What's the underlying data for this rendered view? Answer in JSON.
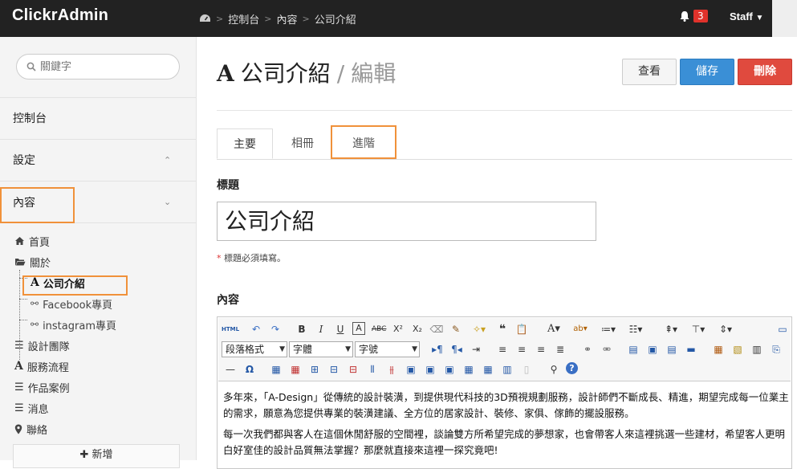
{
  "brand": "ClickrAdmin",
  "breadcrumb": [
    "控制台",
    "內容",
    "公司介紹"
  ],
  "notifications": {
    "count": "3"
  },
  "user": {
    "label": "Staff"
  },
  "sidebar": {
    "search_placeholder": "關鍵字",
    "nav": [
      {
        "label": "控制台"
      },
      {
        "label": "設定",
        "chevron": "^"
      },
      {
        "label": "內容",
        "chevron": "v"
      }
    ],
    "tree": [
      {
        "label": "首頁",
        "icon": "home-icon"
      },
      {
        "label": "關於",
        "icon": "folder-open-icon"
      },
      {
        "label": "公司介紹",
        "icon": "font-icon"
      },
      {
        "label": "Facebook專頁",
        "icon": "link-icon"
      },
      {
        "label": "instagram專頁",
        "icon": "link-icon"
      },
      {
        "label": "設計團隊",
        "icon": "list-icon"
      },
      {
        "label": "服務流程",
        "icon": "font-icon"
      },
      {
        "label": "作品案例",
        "icon": "list-icon"
      },
      {
        "label": "消息",
        "icon": "list-icon"
      },
      {
        "label": "聯絡",
        "icon": "map-marker-icon"
      }
    ],
    "new_button": "新增"
  },
  "page": {
    "title": "公司介紹",
    "subtitle": "編輯",
    "buttons": {
      "view": "查看",
      "save": "儲存",
      "delete": "刪除"
    },
    "tabs": [
      "主要",
      "相冊",
      "進階"
    ],
    "title_label": "標題",
    "title_value": "公司介紹",
    "title_hint": "標題必須填寫。",
    "content_label": "內容"
  },
  "editor": {
    "format_select": "段落格式",
    "font_select": "字體",
    "size_select": "字號",
    "paragraphs": [
      "多年來，「A-Design」從傳統的設計裝潢，到提供現代科技的3D預視規劃服務，設計師們不斷成長、精進，期望完成每一位業主的需求，願意為您提供專業的裝潢建議、全方位的居家設計、裝修、家俱、傢飾的擺設服務。",
      "每一次我們都與客人在這個休閒舒服的空間裡，談論雙方所希望完成的夢想家，也會帶客人來這裡挑選一些建材，希望客人更明白好室佳的設計品質無法掌握？那麼就直接來這裡一探究竟吧!"
    ]
  },
  "colors": {
    "topbar": "#222222",
    "save": "#3a8fd6",
    "delete": "#e04a3e",
    "highlight": "#f0913a"
  }
}
